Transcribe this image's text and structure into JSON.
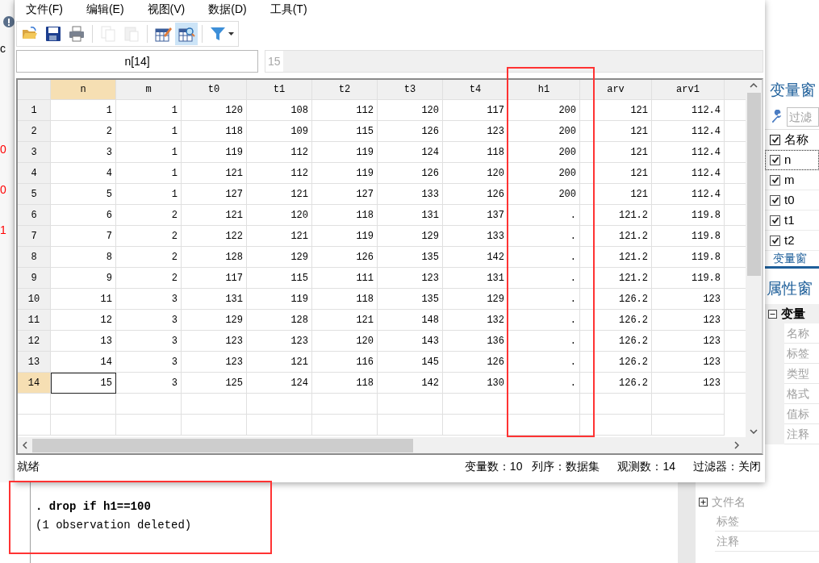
{
  "background_fragments": [
    {
      "text": "c",
      "color": "#000000"
    },
    {
      "text": "0",
      "color": "#ff0000"
    },
    {
      "text": "0",
      "color": "#ff0000"
    },
    {
      "text": "1",
      "color": "#ff0000"
    }
  ],
  "menu": [
    "文件(F)",
    "编辑(E)",
    "视图(V)",
    "数据(D)",
    "工具(T)"
  ],
  "toolbar": [
    [
      {
        "kind": "open",
        "disabled": false,
        "selected": false
      },
      {
        "kind": "save",
        "disabled": false,
        "selected": false
      },
      {
        "kind": "print",
        "disabled": false,
        "selected": false
      }
    ],
    [
      {
        "kind": "copy",
        "disabled": true,
        "selected": false
      },
      {
        "kind": "paste",
        "disabled": true,
        "selected": false
      }
    ],
    [
      {
        "kind": "edit",
        "disabled": false,
        "selected": false
      },
      {
        "kind": "browse",
        "disabled": false,
        "selected": true
      }
    ],
    [
      {
        "kind": "filter",
        "disabled": false,
        "selected": false
      }
    ]
  ],
  "cell_name": "n[14]",
  "cell_value": "15",
  "table": {
    "columns": [
      {
        "label": "n",
        "selected": true
      },
      {
        "label": "m",
        "selected": false
      },
      {
        "label": "t0",
        "selected": false
      },
      {
        "label": "t1",
        "selected": false
      },
      {
        "label": "t2",
        "selected": false
      },
      {
        "label": "t3",
        "selected": false
      },
      {
        "label": "t4",
        "selected": false
      },
      {
        "label": "h1",
        "selected": false
      },
      {
        "label": "arv",
        "selected": false
      },
      {
        "label": "arv1",
        "selected": false
      }
    ],
    "rows": [
      {
        "label": "1",
        "selected": false,
        "cells": [
          "1",
          "1",
          "120",
          "108",
          "112",
          "120",
          "117",
          "200",
          "121",
          "112.4"
        ]
      },
      {
        "label": "2",
        "selected": false,
        "cells": [
          "2",
          "1",
          "118",
          "109",
          "115",
          "126",
          "123",
          "200",
          "121",
          "112.4"
        ]
      },
      {
        "label": "3",
        "selected": false,
        "cells": [
          "3",
          "1",
          "119",
          "112",
          "119",
          "124",
          "118",
          "200",
          "121",
          "112.4"
        ]
      },
      {
        "label": "4",
        "selected": false,
        "cells": [
          "4",
          "1",
          "121",
          "112",
          "119",
          "126",
          "120",
          "200",
          "121",
          "112.4"
        ]
      },
      {
        "label": "5",
        "selected": false,
        "cells": [
          "5",
          "1",
          "127",
          "121",
          "127",
          "133",
          "126",
          "200",
          "121",
          "112.4"
        ]
      },
      {
        "label": "6",
        "selected": false,
        "cells": [
          "6",
          "2",
          "121",
          "120",
          "118",
          "131",
          "137",
          ".",
          "121.2",
          "119.8"
        ]
      },
      {
        "label": "7",
        "selected": false,
        "cells": [
          "7",
          "2",
          "122",
          "121",
          "119",
          "129",
          "133",
          ".",
          "121.2",
          "119.8"
        ]
      },
      {
        "label": "8",
        "selected": false,
        "cells": [
          "8",
          "2",
          "128",
          "129",
          "126",
          "135",
          "142",
          ".",
          "121.2",
          "119.8"
        ]
      },
      {
        "label": "9",
        "selected": false,
        "cells": [
          "9",
          "2",
          "117",
          "115",
          "111",
          "123",
          "131",
          ".",
          "121.2",
          "119.8"
        ]
      },
      {
        "label": "10",
        "selected": false,
        "cells": [
          "11",
          "3",
          "131",
          "119",
          "118",
          "135",
          "129",
          ".",
          "126.2",
          "123"
        ]
      },
      {
        "label": "11",
        "selected": false,
        "cells": [
          "12",
          "3",
          "129",
          "128",
          "121",
          "148",
          "132",
          ".",
          "126.2",
          "123"
        ]
      },
      {
        "label": "12",
        "selected": false,
        "cells": [
          "13",
          "3",
          "123",
          "123",
          "120",
          "143",
          "136",
          ".",
          "126.2",
          "123"
        ]
      },
      {
        "label": "13",
        "selected": false,
        "cells": [
          "14",
          "3",
          "123",
          "121",
          "116",
          "145",
          "126",
          ".",
          "126.2",
          "123"
        ]
      },
      {
        "label": "14",
        "selected": true,
        "cells": [
          "15",
          "3",
          "125",
          "124",
          "118",
          "142",
          "130",
          ".",
          "126.2",
          "123"
        ]
      }
    ]
  },
  "status_bar": {
    "text": "就绪",
    "items": [
      "变量数：10",
      "列序：数据集",
      "观测数：14",
      "过滤器：关闭"
    ]
  },
  "variables_panel": {
    "title": "变量窗",
    "filter_placeholder": "过滤",
    "header": {
      "label": "名称",
      "checked": true
    },
    "items": [
      {
        "name": "n",
        "checked": true,
        "selected": true
      },
      {
        "name": "m",
        "checked": true,
        "selected": false
      },
      {
        "name": "t0",
        "checked": true,
        "selected": false
      },
      {
        "name": "t1",
        "checked": true,
        "selected": false
      },
      {
        "name": "t2",
        "checked": true,
        "selected": false
      }
    ],
    "tab": "变量窗"
  },
  "properties_panel": {
    "title": "属性窗",
    "section": {
      "label": "变量",
      "expanded": true
    },
    "rows": [
      "名称",
      "标签",
      "类型",
      "格式",
      "值标",
      "注释"
    ]
  },
  "data_panel": {
    "section": {
      "label": "文件名",
      "expanded": false
    },
    "rows": [
      "标签",
      "注释"
    ]
  },
  "results": [
    {
      "kind": "command",
      "text": ". drop if h1==100"
    },
    {
      "kind": "output",
      "text": "(1 observation deleted)"
    }
  ]
}
